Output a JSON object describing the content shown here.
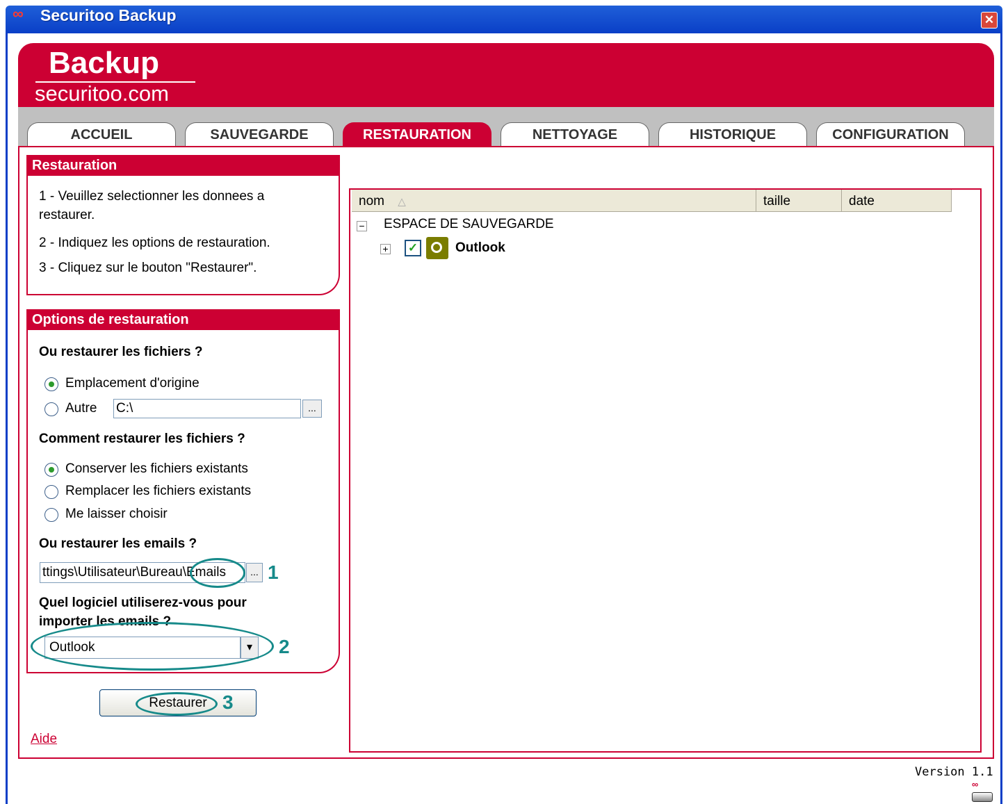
{
  "window": {
    "title": "Securitoo Backup",
    "logo_glyph": "∞",
    "close_glyph": "✕"
  },
  "brand": {
    "title": "Backup",
    "subtitle": "securitoo.com"
  },
  "tabs": [
    {
      "label": "ACCUEIL",
      "active": false
    },
    {
      "label": "SAUVEGARDE",
      "active": false
    },
    {
      "label": "RESTAURATION",
      "active": true
    },
    {
      "label": "NETTOYAGE",
      "active": false
    },
    {
      "label": "HISTORIQUE",
      "active": false
    },
    {
      "label": "CONFIGURATION",
      "active": false
    }
  ],
  "restauration_panel": {
    "title": "Restauration",
    "steps": [
      "1 - Veuillez selectionner les donnees a",
      "restaurer.",
      "2 - Indiquez les options de restauration.",
      "3 - Cliquez sur le bouton \"Restaurer\"."
    ]
  },
  "options_panel": {
    "title": "Options de restauration",
    "where_files_label": "Ou restaurer les fichiers ?",
    "where_files_options": [
      {
        "label": "Emplacement d'origine",
        "selected": true
      },
      {
        "label": "Autre",
        "selected": false
      }
    ],
    "other_path_value": "C:\\",
    "browse_glyph": "...",
    "how_files_label": "Comment restaurer les fichiers ?",
    "how_files_options": [
      {
        "label": "Conserver les fichiers existants",
        "selected": true
      },
      {
        "label": "Remplacer les fichiers existants",
        "selected": false
      },
      {
        "label": "Me laisser choisir",
        "selected": false
      }
    ],
    "where_emails_label": "Ou restaurer les emails ?",
    "emails_path_value": "ttings\\Utilisateur\\Bureau\\Emails",
    "software_label_line1": "Quel logiciel utiliserez-vous pour",
    "software_label_line2": "importer les emails ?",
    "software_selected": "Outlook",
    "dropdown_glyph": "▾",
    "restore_button": "Restaurer",
    "help_link": "Aide"
  },
  "annotations": {
    "one": "1",
    "two": "2",
    "three": "3",
    "color": "#168a8a"
  },
  "tree": {
    "columns": [
      "nom",
      "taille",
      "date"
    ],
    "sort_glyph": "△",
    "root_label": "ESPACE DE SAUVEGARDE",
    "root_expander": "−",
    "child_expander": "+",
    "child_label": "Outlook",
    "child_checked": true,
    "check_glyph": "✓"
  },
  "status": {
    "version": "Version 1.1",
    "tray_glyph": "∞"
  },
  "colors": {
    "brand_red": "#cc0033",
    "titlebar_blue": "#0a3fc7",
    "tab_gray": "#c0c0c0"
  }
}
